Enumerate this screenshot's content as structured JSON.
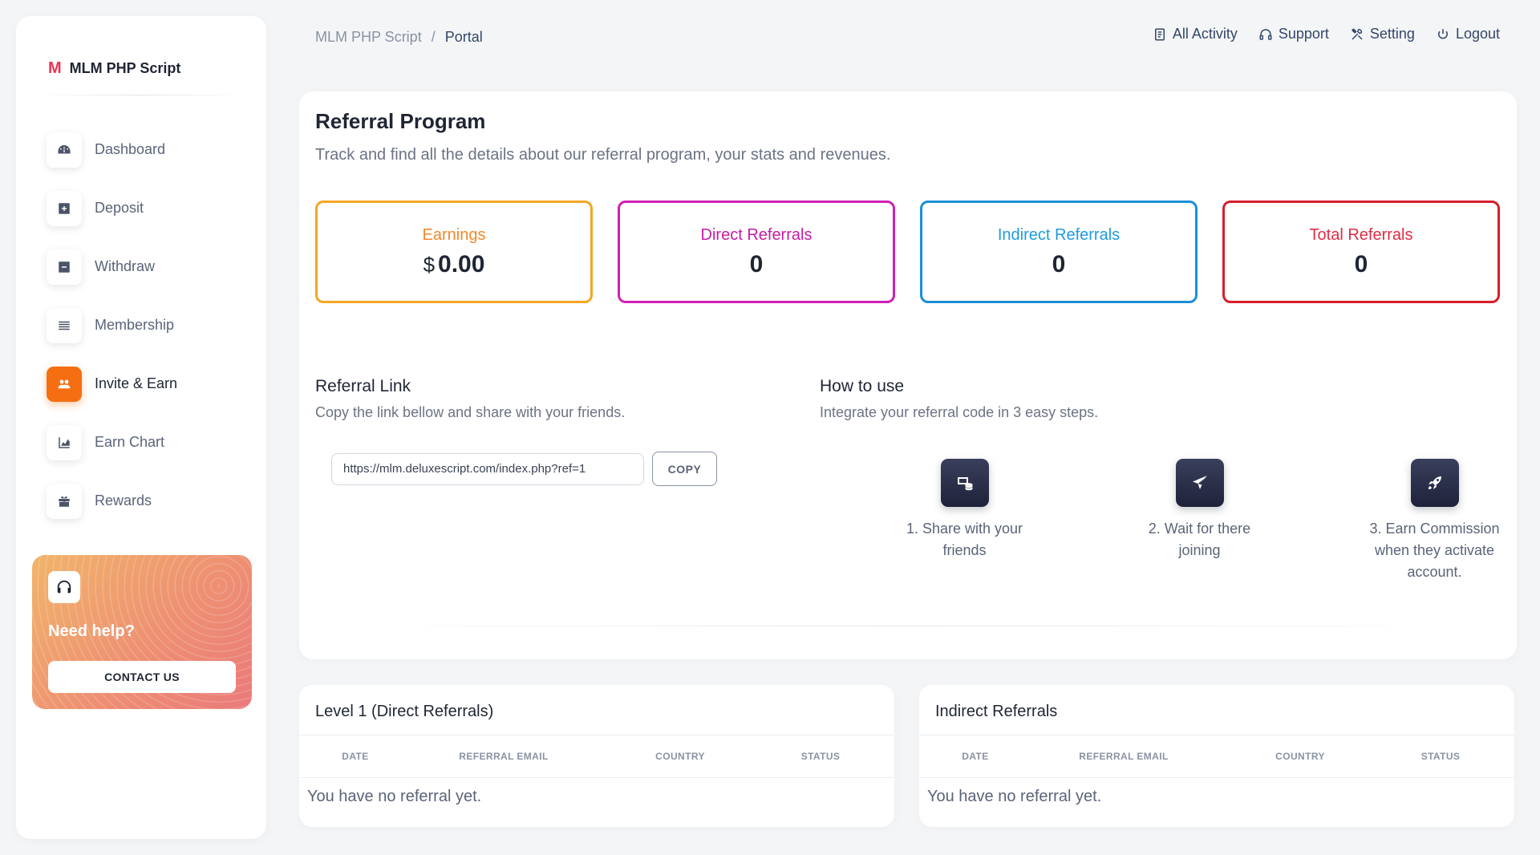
{
  "brand": {
    "logo": "M",
    "name": "MLM PHP Script"
  },
  "sidebar": {
    "items": [
      {
        "label": "Dashboard",
        "icon": "dashboard-icon"
      },
      {
        "label": "Deposit",
        "icon": "plus-square-icon"
      },
      {
        "label": "Withdraw",
        "icon": "minus-square-icon"
      },
      {
        "label": "Membership",
        "icon": "list-icon"
      },
      {
        "label": "Invite & Earn",
        "icon": "users-icon",
        "active": true
      },
      {
        "label": "Earn Chart",
        "icon": "area-chart-icon"
      },
      {
        "label": "Rewards",
        "icon": "gift-icon"
      }
    ],
    "help": {
      "title": "Need help?",
      "button": "CONTACT US",
      "icon": "headphones-icon"
    }
  },
  "breadcrumb": {
    "parent": "MLM PHP Script",
    "separator": "/",
    "current": "Portal"
  },
  "toplinks": {
    "activity": "All Activity",
    "support": "Support",
    "setting": "Setting",
    "logout": "Logout"
  },
  "main": {
    "title": "Referral Program",
    "subtitle": "Track and find all the details about our referral program, your stats and revenues.",
    "stats": [
      {
        "label": "Earnings",
        "currency": "$",
        "value": "0.00",
        "color": "#f5a623",
        "label_color": "#f0892b"
      },
      {
        "label": "Direct Referrals",
        "value": "0",
        "color": "#d11fb6",
        "label_color": "#c21ea6"
      },
      {
        "label": "Indirect Referrals",
        "value": "0",
        "color": "#1c8fd6",
        "label_color": "#1e9be0"
      },
      {
        "label": "Total Referrals",
        "value": "0",
        "color": "#d81d2c",
        "label_color": "#de2d45"
      }
    ],
    "referral_link": {
      "title": "Referral Link",
      "subtitle": "Copy the link bellow and share with your friends.",
      "url": "https://mlm.deluxescript.com/index.php?ref=1",
      "copy_label": "COPY"
    },
    "how_to_use": {
      "title": "How to use",
      "subtitle": "Integrate your referral code in 3 easy steps.",
      "steps": [
        {
          "text": "1. Share with your friends",
          "icon": "coins-icon"
        },
        {
          "text": "2. Wait for there joining",
          "icon": "paper-plane-icon"
        },
        {
          "text": "3. Earn Commission when they activate account.",
          "icon": "rocket-icon"
        }
      ]
    }
  },
  "tables": {
    "columns": [
      "DATE",
      "REFERRAL EMAIL",
      "COUNTRY",
      "STATUS"
    ],
    "direct": {
      "title": "Level 1 (Direct Referrals)",
      "empty": "You have no referral yet."
    },
    "indirect": {
      "title": "Indirect Referrals",
      "empty": "You have no referral yet."
    }
  }
}
